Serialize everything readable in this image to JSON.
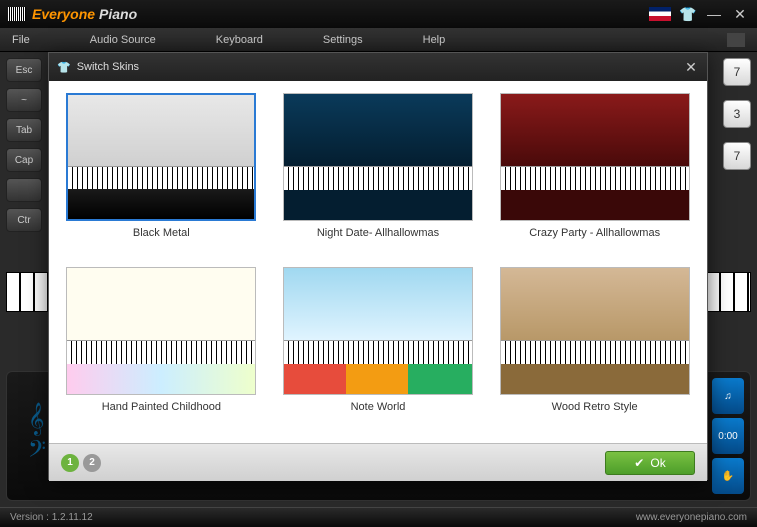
{
  "titlebar": {
    "brand_first": "Everyone",
    "brand_second": "Piano"
  },
  "menu": {
    "file": "File",
    "audio": "Audio Source",
    "keyboard": "Keyboard",
    "settings": "Settings",
    "help": "Help"
  },
  "side_keys": [
    "Esc",
    "~",
    "Tab",
    "Cap",
    "",
    "Ctr"
  ],
  "right_keys": [
    "7",
    "3",
    "7"
  ],
  "bottom_panel": {
    "time": "0:00"
  },
  "modal": {
    "title": "Switch Skins",
    "skins": [
      {
        "name": "Black Metal",
        "thumb_class": "th-blackmetal",
        "selected": true
      },
      {
        "name": "Night Date- Allhallowmas",
        "thumb_class": "th-night",
        "selected": false
      },
      {
        "name": "Crazy Party - Allhallowmas",
        "thumb_class": "th-crazy",
        "selected": false
      },
      {
        "name": "Hand Painted Childhood",
        "thumb_class": "th-child",
        "selected": false
      },
      {
        "name": "Note World",
        "thumb_class": "th-note",
        "selected": false
      },
      {
        "name": "Wood Retro Style",
        "thumb_class": "th-wood",
        "selected": false
      }
    ],
    "pages": [
      "1",
      "2"
    ],
    "active_page": "1",
    "ok_label": "Ok"
  },
  "statusbar": {
    "version_label": "Version :",
    "version": "1.2.11.12",
    "url": "www.everyonepiano.com"
  }
}
